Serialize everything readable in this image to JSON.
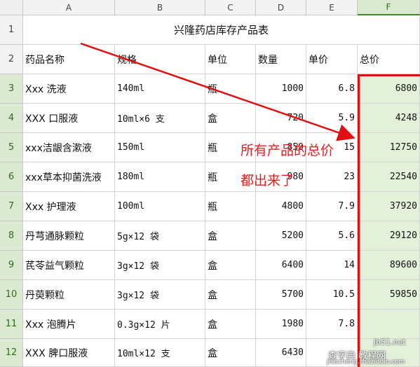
{
  "columns": [
    "A",
    "B",
    "C",
    "D",
    "E",
    "F"
  ],
  "rows": [
    "1",
    "2",
    "3",
    "4",
    "5",
    "6",
    "7",
    "8",
    "9",
    "10",
    "11",
    "12"
  ],
  "title": "兴隆药店库存产品表",
  "headers": [
    "药品名称",
    "规格",
    "单位",
    "数量",
    "单价",
    "总价"
  ],
  "data": [
    [
      "Xxx 洗液",
      "140ml",
      "瓶",
      "1000",
      "6.8",
      "6800"
    ],
    [
      " XXX 口服液",
      " 10ml×6 支",
      "盒",
      "720",
      "5.9",
      "4248"
    ],
    [
      " xxx洁龈含漱液",
      "150ml",
      "瓶",
      "850",
      "15",
      "12750"
    ],
    [
      "xxx草本抑菌洗液",
      "180ml",
      "瓶",
      "980",
      "23",
      "22540"
    ],
    [
      "Xxx 护理液",
      "100ml",
      "瓶",
      "4800",
      "7.9",
      "37920"
    ],
    [
      "丹芎通脉颗粒",
      "5g×12 袋",
      "盒",
      "5200",
      "5.6",
      "29120"
    ],
    [
      "芪苓益气颗粒",
      "3g×12 袋",
      "盒",
      "6400",
      "14",
      "89600"
    ],
    [
      "丹萸颗粒",
      "3g×12 袋",
      "盒",
      "5700",
      "10.5",
      "59850"
    ],
    [
      "Xxx 泡腾片",
      "0.3g×12 片",
      "盒",
      "1980",
      "7.8",
      ""
    ],
    [
      "XXX 脾口服液",
      "10ml×12 支",
      "盒",
      "6430",
      "",
      ""
    ]
  ],
  "annotation": {
    "line1": "所有产品的总价",
    "line2": "都出来了"
  },
  "watermark": {
    "site": "jb51.net",
    "cn": "查字典 教程网",
    "url": "jiaocheng.chazidian.com"
  },
  "colors": {
    "annotation": "#e81e1e",
    "selected_column": "#e3f1da"
  }
}
